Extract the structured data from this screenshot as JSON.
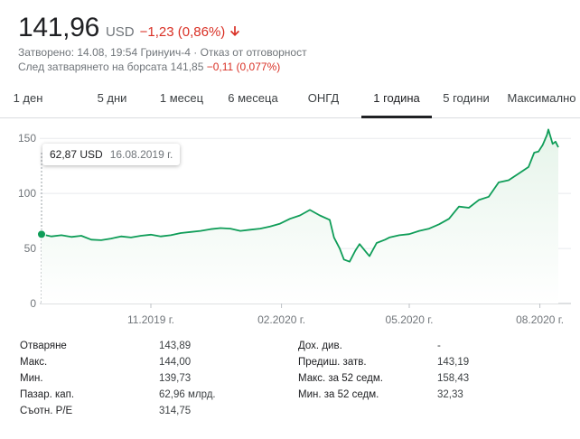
{
  "header": {
    "price": "141,96",
    "currency": "USD",
    "change": "−1,23 (0,86%)",
    "closed_line": "Затворено: 14.08, 19:54 Гринуич-4 · Отказ от отговорност",
    "after_hours_label": "След затварянето на борсата 141,85",
    "after_hours_change": "−0,11 (0,077%)"
  },
  "tabs": [
    {
      "label": "1 ден"
    },
    {
      "label": "5 дни"
    },
    {
      "label": "1 месец"
    },
    {
      "label": "6 месеца"
    },
    {
      "label": "ОНГД"
    },
    {
      "label": "1 година",
      "active": true
    },
    {
      "label": "5 години"
    },
    {
      "label": "Максимално"
    }
  ],
  "tooltip": {
    "value": "62,87 USD",
    "date": "16.08.2019 г."
  },
  "colors": {
    "line": "#0f9d58",
    "area": "#e6f4ea",
    "negative": "#d93025",
    "grid": "#e8eaed"
  },
  "chart_data": {
    "type": "area",
    "ylim": [
      0,
      160
    ],
    "yticks": [
      "0",
      "50",
      "100",
      "150"
    ],
    "xticks": [
      "11.2019 г.",
      "02.2020 г.",
      "05.2020 г.",
      "08.2020 г."
    ],
    "x_range": [
      "2019-08-16",
      "2020-08-14"
    ],
    "series": [
      {
        "points": [
          [
            "2019-08-16",
            62.87
          ],
          [
            "2019-08-23",
            61
          ],
          [
            "2019-08-30",
            62
          ],
          [
            "2019-09-06",
            60.5
          ],
          [
            "2019-09-13",
            61.5
          ],
          [
            "2019-09-20",
            58
          ],
          [
            "2019-09-27",
            57.5
          ],
          [
            "2019-10-04",
            59
          ],
          [
            "2019-10-11",
            61
          ],
          [
            "2019-10-18",
            60
          ],
          [
            "2019-10-25",
            61.5
          ],
          [
            "2019-11-01",
            62.5
          ],
          [
            "2019-11-08",
            61
          ],
          [
            "2019-11-15",
            62
          ],
          [
            "2019-11-22",
            64
          ],
          [
            "2019-11-29",
            65
          ],
          [
            "2019-12-06",
            66
          ],
          [
            "2019-12-13",
            67.5
          ],
          [
            "2019-12-20",
            68.5
          ],
          [
            "2019-12-27",
            68
          ],
          [
            "2020-01-03",
            66
          ],
          [
            "2020-01-10",
            67
          ],
          [
            "2020-01-17",
            68
          ],
          [
            "2020-01-24",
            70
          ],
          [
            "2020-01-31",
            72.5
          ],
          [
            "2020-02-07",
            77
          ],
          [
            "2020-02-14",
            80
          ],
          [
            "2020-02-21",
            85
          ],
          [
            "2020-02-28",
            80
          ],
          [
            "2020-03-06",
            76
          ],
          [
            "2020-03-09",
            60
          ],
          [
            "2020-03-13",
            50
          ],
          [
            "2020-03-16",
            40
          ],
          [
            "2020-03-20",
            38
          ],
          [
            "2020-03-24",
            48
          ],
          [
            "2020-03-27",
            54
          ],
          [
            "2020-04-01",
            46
          ],
          [
            "2020-04-03",
            43
          ],
          [
            "2020-04-08",
            55
          ],
          [
            "2020-04-14",
            58
          ],
          [
            "2020-04-17",
            60
          ],
          [
            "2020-04-24",
            62
          ],
          [
            "2020-05-01",
            63
          ],
          [
            "2020-05-08",
            66
          ],
          [
            "2020-05-15",
            68
          ],
          [
            "2020-05-22",
            72
          ],
          [
            "2020-05-29",
            77
          ],
          [
            "2020-06-05",
            88
          ],
          [
            "2020-06-12",
            87
          ],
          [
            "2020-06-19",
            94
          ],
          [
            "2020-06-26",
            97
          ],
          [
            "2020-07-03",
            110
          ],
          [
            "2020-07-10",
            112
          ],
          [
            "2020-07-17",
            118
          ],
          [
            "2020-07-24",
            124
          ],
          [
            "2020-07-28",
            137
          ],
          [
            "2020-07-31",
            138
          ],
          [
            "2020-08-03",
            144
          ],
          [
            "2020-08-06",
            153
          ],
          [
            "2020-08-07",
            158
          ],
          [
            "2020-08-10",
            145
          ],
          [
            "2020-08-12",
            147
          ],
          [
            "2020-08-14",
            141.96
          ]
        ]
      }
    ]
  },
  "stats": {
    "left": [
      {
        "label": "Отваряне",
        "value": "143,89"
      },
      {
        "label": "Макс.",
        "value": "144,00"
      },
      {
        "label": "Мин.",
        "value": "139,73"
      },
      {
        "label": "Пазар. кап.",
        "value": "62,96 млрд."
      },
      {
        "label": "Съотн. P/E",
        "value": "314,75"
      }
    ],
    "right": [
      {
        "label": "Дох. див.",
        "value": "-"
      },
      {
        "label": "Предиш. затв.",
        "value": "143,19"
      },
      {
        "label": "Макс. за 52 седм.",
        "value": "158,43"
      },
      {
        "label": "Мин. за 52 седм.",
        "value": "32,33"
      }
    ]
  }
}
